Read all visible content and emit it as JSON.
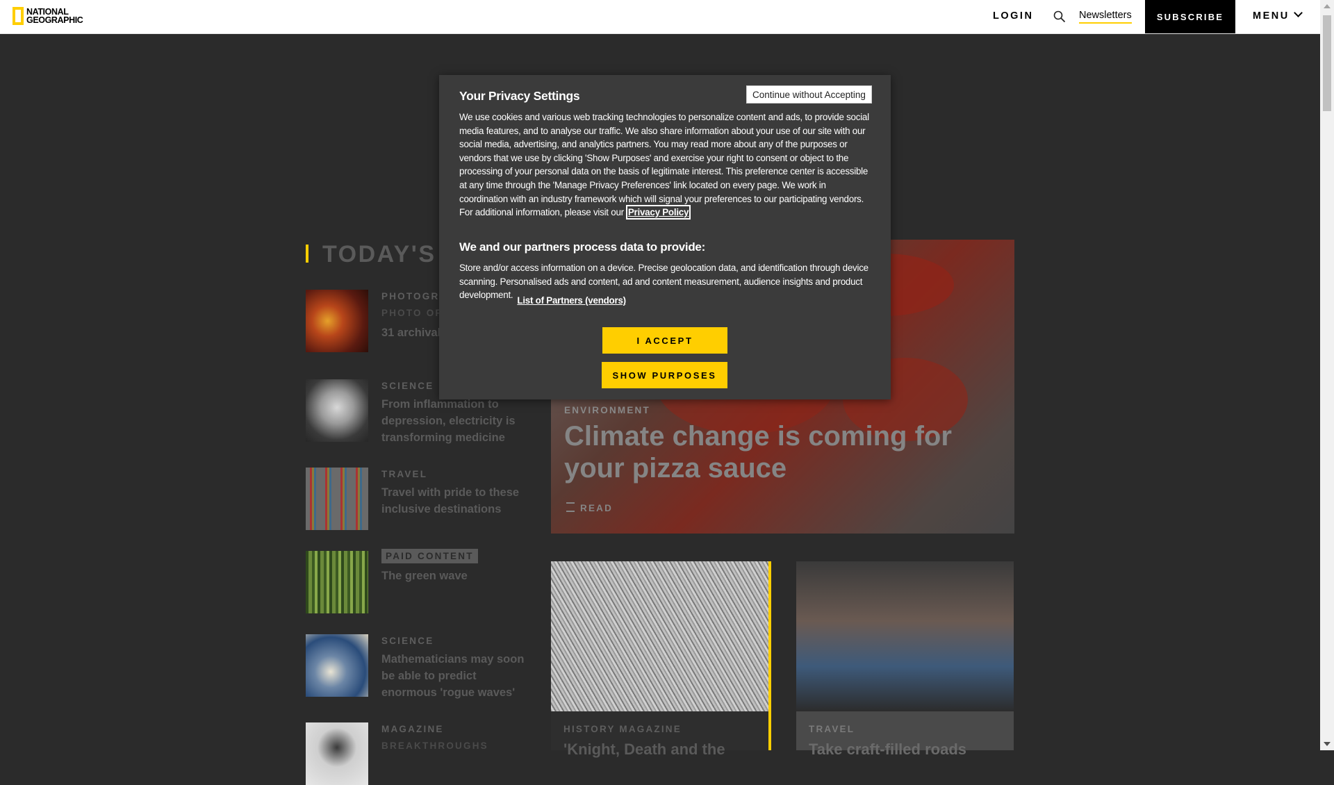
{
  "nav": {
    "logo_line1": "NATIONAL",
    "logo_line2": "GEOGRAPHIC",
    "login": "LOGIN",
    "newsletters": "Newsletters",
    "subscribe": "SUBSCRIBE",
    "menu": "MENU"
  },
  "section": {
    "title": "TODAY'S"
  },
  "left_stories": [
    {
      "kicker": "PHOTOGR",
      "sub": "PHOTO OF",
      "headline": "31 archival ignite your"
    },
    {
      "kicker": "SCIENCE",
      "headline": "From inflammation to depression, electricity is transforming medicine"
    },
    {
      "kicker": "TRAVEL",
      "headline": "Travel with pride to these inclusive destinations"
    },
    {
      "kicker": "PAID CONTENT",
      "headline": "The green wave"
    },
    {
      "kicker": "SCIENCE",
      "headline": "Mathematicians may soon be able to predict enormous 'rogue waves'"
    },
    {
      "kicker": "MAGAZINE",
      "sub": "BREAKTHROUGHS"
    }
  ],
  "hero": {
    "kicker": "ENVIRONMENT",
    "title": "Climate change is coming for your pizza sauce",
    "read": "READ"
  },
  "cards": [
    {
      "kicker": "HISTORY MAGAZINE",
      "headline": "'Knight, Death and the"
    },
    {
      "kicker": "TRAVEL",
      "headline": "Take craft-filled roads"
    }
  ],
  "modal": {
    "title": "Your Privacy Settings",
    "continue_label": "Continue without Accepting",
    "body": "We use cookies and various web tracking technologies to personalize content and ads, to provide social media features, and to analyse our traffic. We also share information about your use of our site with our social media, advertising, and analytics partners. You may read more about any of the purposes or vendors that we use by clicking 'Show Purposes' and exercise your right to consent or object to the processing of your personal data on the basis of legitimate interest. This preference center is accessible at any time through the 'Manage Privacy Preferences' link located on every page. We work in coordination with an industry framework which will signal your preferences to our participating vendors.",
    "additional_info": "For additional information, please visit our",
    "privacy_policy": "Privacy Policy",
    "process_heading": "We and our partners process data to provide:",
    "purposes": "Store and/or access information on a device. Precise geolocation data, and identification through device scanning. Personalised ads and content, ad and content measurement, audience insights and product development.",
    "partners_link": "List of Partners (vendors)",
    "accept": "I ACCEPT",
    "show_purposes": "SHOW PURPOSES"
  },
  "colors": {
    "accent": "#ffce00",
    "modal_bg": "#3b3b3b",
    "page_bg": "#2b2b2b"
  }
}
